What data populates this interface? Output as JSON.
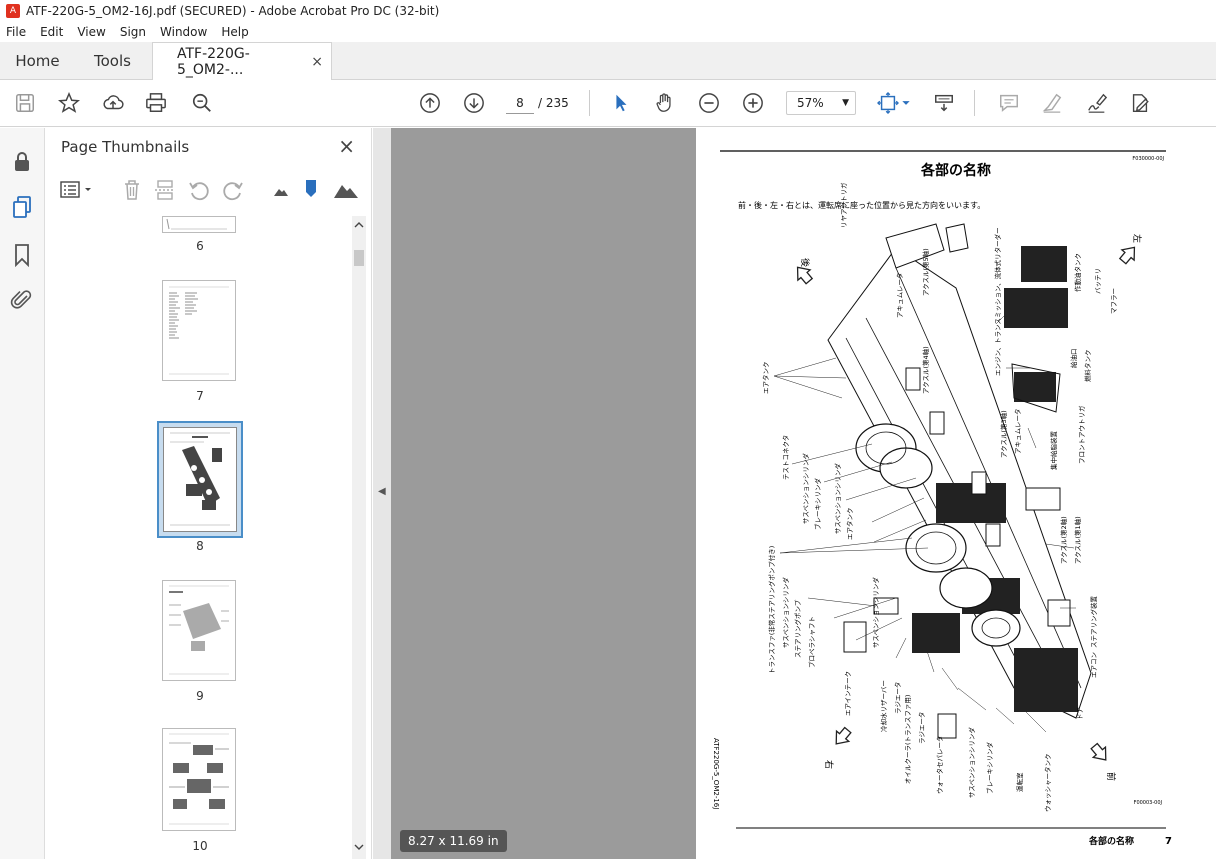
{
  "window": {
    "title": "ATF-220G-5_OM2-16J.pdf (SECURED) - Adobe Acrobat Pro DC (32-bit)"
  },
  "menu": [
    "File",
    "Edit",
    "View",
    "Sign",
    "Window",
    "Help"
  ],
  "tabs": {
    "home": "Home",
    "tools": "Tools",
    "doc": "ATF-220G-5_OM2-...",
    "close": "×"
  },
  "toolbar": {
    "page_current": "8",
    "page_total": "/ 235",
    "zoom": "57%"
  },
  "sidebar": {
    "title": "Page Thumbnails",
    "close": "×",
    "thumbnails": [
      {
        "label": "6"
      },
      {
        "label": "7"
      },
      {
        "label": "8",
        "selected": true
      },
      {
        "label": "9"
      },
      {
        "label": "10"
      }
    ]
  },
  "status": {
    "page_size": "8.27 x 11.69 in"
  },
  "document": {
    "heading": "各部の名称",
    "doc_code": "F030000-00J",
    "intro": "前・後・左・右とは、運転席に座った位置から見た方向をいいます。",
    "dir_back": "後",
    "dir_left": "左",
    "dir_right": "右",
    "dir_front": "前",
    "side_code": "ATF220G-5_OM2-16J",
    "figure_code": "F00003-00J",
    "footer_title": "各部の名称",
    "footer_page": "7",
    "labels_left": [
      "リヤアウトリガ",
      "アキュムレータ",
      "アクスル(第5軸)",
      "エアタンク",
      "アクスル(第4軸)",
      "テストコネクタ",
      "サスペンションシリンダ",
      "ブレーキシリンダ",
      "サスペンションシリンダ",
      "エアタンク",
      "トランスファ(非常ステアリングポンプ付き)",
      "サスペンションシリンダ",
      "ステアリングポンプ",
      "プロペラシャフト",
      "サスペンションシリンダ",
      "エアインテーク",
      "冷却水リザーバー",
      "ラジエータ",
      "オイルクーラ(トランスファ用)",
      "ラジエータ",
      "ウォータセパレータ",
      "サスペンションシリンダ",
      "ブレーキシリンダ",
      "運転室",
      "ウォッシャータンク"
    ],
    "labels_right": [
      "作動油タンク",
      "バッテリ",
      "マフラー",
      "エンジン、トランスミッション、流体式リターダー",
      "給油口",
      "燃料タンク",
      "アクスル(第3軸)",
      "アキュムレータ",
      "集中給脂装置",
      "フロントアウトリガ",
      "アクスル(第2軸)",
      "アクスル(第1軸)",
      "ステアリング装置",
      "エアコン",
      "ドア"
    ]
  },
  "colors": {
    "accent": "#4a8ec8",
    "canvas": "#9b9b9b",
    "pdf_red": "#e0311f"
  }
}
